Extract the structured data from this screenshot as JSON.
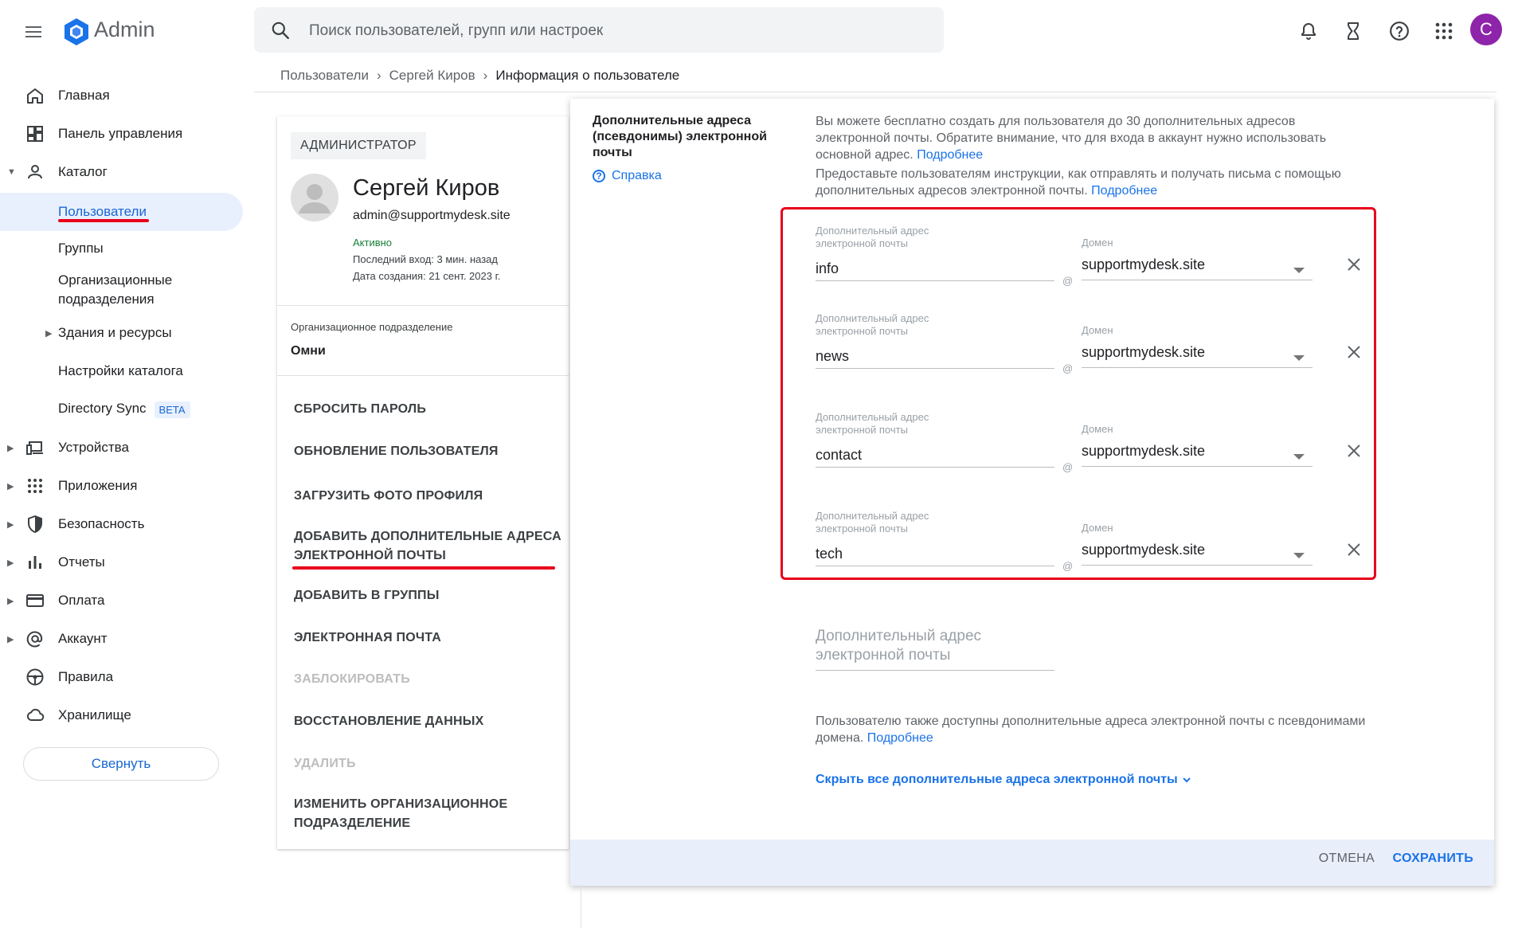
{
  "app": {
    "title": "Admin",
    "brand_color": "#1a73e8"
  },
  "search": {
    "placeholder": "Поиск пользователей, групп или настроек"
  },
  "user_avatar_letter": "C",
  "breadcrumb": [
    "Пользователи",
    "Сергей Киров",
    "Информация о пользователе"
  ],
  "sidebar": {
    "items": [
      {
        "label": "Главная",
        "icon": "home-icon"
      },
      {
        "label": "Панель управления",
        "icon": "dashboard-icon"
      },
      {
        "label": "Каталог",
        "icon": "person-icon"
      },
      {
        "label": "Пользователи"
      },
      {
        "label": "Группы"
      },
      {
        "label": "Организационные подразделения"
      },
      {
        "label": "Здания и ресурсы"
      },
      {
        "label": "Настройки каталога"
      },
      {
        "label": "Directory Sync",
        "badge": "BETA"
      },
      {
        "label": "Устройства",
        "icon": "devices-icon"
      },
      {
        "label": "Приложения",
        "icon": "apps-icon"
      },
      {
        "label": "Безопасность",
        "icon": "shield-icon"
      },
      {
        "label": "Отчеты",
        "icon": "bar-chart-icon"
      },
      {
        "label": "Оплата",
        "icon": "credit-card-icon"
      },
      {
        "label": "Аккаунт",
        "icon": "at-icon"
      },
      {
        "label": "Правила",
        "icon": "steering-wheel-icon"
      },
      {
        "label": "Хранилище",
        "icon": "cloud-icon"
      }
    ],
    "collapse_label": "Свернуть"
  },
  "user_card": {
    "role": "АДМИНИСТРАТОР",
    "name": "Сергей Киров",
    "email": "admin@supportmydesk.site",
    "status": "Активно",
    "last_login": "Последний вход: 3 мин. назад",
    "created": "Дата создания: 21 сент. 2023 г.",
    "org_label": "Организационное подразделение",
    "org_value": "Омни",
    "actions": [
      {
        "label": "СБРОСИТЬ ПАРОЛЬ",
        "enabled": true
      },
      {
        "label": "ОБНОВЛЕНИЕ ПОЛЬЗОВАТЕЛЯ",
        "enabled": true
      },
      {
        "label": "ЗАГРУЗИТЬ ФОТО ПРОФИЛЯ",
        "enabled": true
      },
      {
        "label": "ДОБАВИТЬ ДОПОЛНИТЕЛЬНЫЕ АДРЕСА ЭЛЕКТРОННОЙ ПОЧТЫ",
        "enabled": true
      },
      {
        "label": "ДОБАВИТЬ В ГРУППЫ",
        "enabled": true
      },
      {
        "label": "ЭЛЕКТРОННАЯ ПОЧТА",
        "enabled": true
      },
      {
        "label": "ЗАБЛОКИРОВАТЬ",
        "enabled": false
      },
      {
        "label": "ВОССТАНОВЛЕНИЕ ДАННЫХ",
        "enabled": true
      },
      {
        "label": "УДАЛИТЬ",
        "enabled": false
      },
      {
        "label": "ИЗМЕНИТЬ ОРГАНИЗАЦИОННОЕ ПОДРАЗДЕЛЕНИЕ",
        "enabled": true
      }
    ]
  },
  "dialog": {
    "section_title": "Дополнительные адреса (псевдонимы) электронной почты",
    "help_label": "Справка",
    "info1_text": "Вы можете бесплатно создать для пользователя до 30 дополнительных адресов электронной почты. Обратите внимание, что для входа в аккаунт нужно использовать основной адрес.",
    "info2_text": "Предоставьте пользователям инструкции, как отправлять и получать письма с помощью дополнительных адресов электронной почты.",
    "more_link": "Подробнее",
    "alias_label": "Дополнительный адрес электронной почты",
    "domain_label": "Домен",
    "at_sign": "@",
    "aliases": [
      {
        "value": "info",
        "domain": "supportmydesk.site"
      },
      {
        "value": "news",
        "domain": "supportmydesk.site"
      },
      {
        "value": "contact",
        "domain": "supportmydesk.site"
      },
      {
        "value": "tech",
        "domain": "supportmydesk.site"
      }
    ],
    "new_alias_placeholder": "Дополнительный адрес электронной почты",
    "domain_note_text": "Пользователю также доступны дополнительные адреса электронной почты с псевдонимами домена.",
    "hide_link": "Скрыть все дополнительные адреса электронной почты",
    "cancel_label": "ОТМЕНА",
    "save_label": "СОХРАНИТЬ"
  }
}
